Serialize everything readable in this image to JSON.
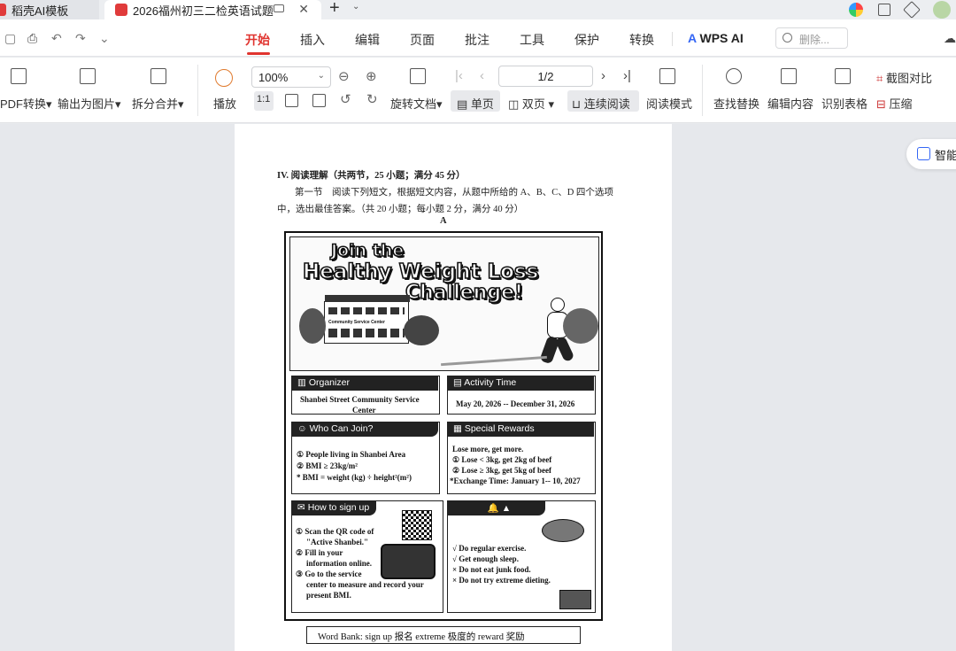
{
  "tabs": [
    {
      "label": "稻壳AI模板"
    },
    {
      "label": "2026福州初三二检英语试题"
    }
  ],
  "menu": {
    "items": [
      "开始",
      "插入",
      "编辑",
      "页面",
      "批注",
      "工具",
      "保护",
      "转换"
    ],
    "ai_label": "WPS AI",
    "search_placeholder": "删除..."
  },
  "ribbon": {
    "pdf_convert": "PDF转换",
    "export_image": "输出为图片",
    "split_merge": "拆分合并",
    "play": "播放",
    "zoom": "100%",
    "rotate": "旋转文档",
    "single_page": "单页",
    "double_page": "双页",
    "continuous": "连续阅读",
    "page_indicator": "1/2",
    "reading_mode": "阅读模式",
    "find_replace": "查找替换",
    "edit_content": "编辑内容",
    "recognize_table": "识别表格",
    "screenshot_compare": "截图对比",
    "compress": "压缩"
  },
  "side_pill": {
    "label": "智能"
  },
  "document": {
    "section_heading": "IV. 阅读理解（共两节，25 小题；满分 45 分）",
    "instruction_1": "第一节　阅读下列短文，根据短文内容，从题中所给的 A、B、C、D 四个选项",
    "instruction_2": "中，选出最佳答案。（共 20 小题；每小题 2 分，满分 40 分）",
    "passage_label": "A",
    "poster": {
      "title_1": "Join the",
      "title_2": "Healthy Weight Loss",
      "title_3": "Challenge!",
      "building_sign": "Community Service Center",
      "organizer": {
        "header": "Organizer",
        "line1": "Shanbei Street Community Service",
        "line2": "Center"
      },
      "activity_time": {
        "header": "Activity Time",
        "text": "May 20, 2026 -- December 31, 2026"
      },
      "who_can_join": {
        "header": "Who Can Join?",
        "line1": "① People living in Shanbei Area",
        "line2": "② BMI ≥ 23kg/m²",
        "line3": "* BMI = weight (kg) ÷ height²(m²)"
      },
      "special_rewards": {
        "header": "Special Rewards",
        "line1": "Lose more, get more.",
        "line2": "① Lose < 3kg, get 2kg of beef",
        "line3": "② Lose ≥ 3kg, get 5kg of beef",
        "line4": "*Exchange Time: January 1-- 10, 2027"
      },
      "sign_up": {
        "header": "How to sign up",
        "line1": "① Scan the QR code of",
        "line2": "\"Active Shanbei.\"",
        "line3": "② Fill in your",
        "line4": "information online.",
        "line5": "③ Go to the service",
        "line6": "center to measure and record your",
        "line7": "present BMI."
      },
      "tips": {
        "header": "▲",
        "line1": "√ Do regular exercise.",
        "line2": "√ Get enough sleep.",
        "line3": "× Do not eat junk food.",
        "line4": "× Do not try extreme dieting."
      }
    },
    "word_bank": "Word Bank: sign up  报名      extreme  极度的        reward  奖励"
  }
}
